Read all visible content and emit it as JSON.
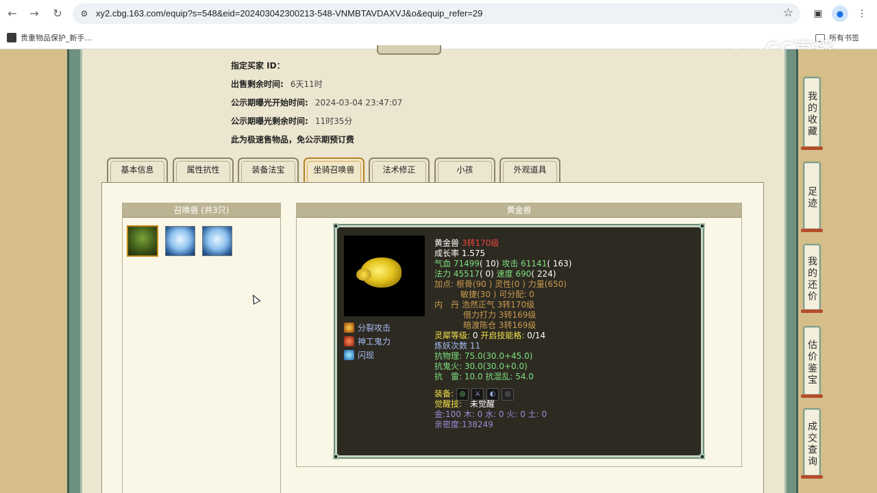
{
  "browser": {
    "url": "xy2.cbg.163.com/equip?s=548&eid=202403042300213-548-VNMBTAVDAXVJ&o&equip_refer=29",
    "bookmark": "贵重物品保护_新手...",
    "bookmarks_folder": "所有书签",
    "watermark": "CC直播",
    "icons": [
      "back-icon",
      "forward-icon",
      "reload-icon",
      "site-settings-icon",
      "star-icon",
      "sidebar-icon",
      "profile-icon",
      "menu-icon"
    ]
  },
  "info": {
    "rows": [
      {
        "label": "指定买家 ID：",
        "value": ""
      },
      {
        "label": "出售剩余时间:",
        "value": "6天11时"
      },
      {
        "label": "公示期曝光开始时间:",
        "value": "2024-03-04 23:47:07"
      },
      {
        "label": "公示期曝光剩余时间:",
        "value": "11时35分"
      },
      {
        "label": "此为极速售物品，免公示期预订费",
        "value": ""
      }
    ]
  },
  "tabs": [
    "基本信息",
    "属性抗性",
    "装备法宝",
    "坐骑召唤兽",
    "法术修正",
    "小孩",
    "外观道具"
  ],
  "active_tab": "坐骑召唤兽",
  "pets_panel": {
    "title": "召唤兽 (共3只)",
    "icons": [
      "green-warrior-pet-icon",
      "ice-pet-icon",
      "ice-pet-icon"
    ]
  },
  "detail": {
    "title": "黄金兽",
    "name": "黄金兽",
    "level": "3转170级",
    "growth": "成长率 1.575",
    "hp": {
      "label": "气血",
      "value": "71499",
      "extra": "( 10)"
    },
    "attack": {
      "label": "攻击",
      "value": "61141",
      "extra": "( 163)"
    },
    "mp": {
      "label": "法力",
      "value": "45517",
      "extra": "( 0)"
    },
    "speed": {
      "label": "速度",
      "value": "690",
      "extra": "( 224)"
    },
    "points_line1": "加点: 根骨(90 ) 灵性(0 ) 力量(650)",
    "points_line2": "敏捷(30 ) 可分配: 0",
    "neidan_label": "内　丹",
    "neidan": [
      "浩然正气 3转170级",
      "借力打力 3转169级",
      "暗渡陈仓 3转169级"
    ],
    "linxi_label": "灵犀等级:",
    "linxi_value": "0",
    "skill_cap_label": "开启技能格:",
    "skill_cap_value": "0/14",
    "lianyao": "炼妖次数 11",
    "resist1": "抗物理: 75.0(30.0+45.0)",
    "resist2": "抗鬼火: 30.0(30.0+0.0)",
    "resist3": "抗　雷: 10.0 抗混乱: 54.0",
    "equip_label": "装备:",
    "awake_label": "觉醒技:",
    "awake_value": "未觉醒",
    "elements": "金:100 木: 0 水: 0 火: 0 土: 0",
    "intimacy": "亲密度:138249",
    "skills": [
      "分裂攻击",
      "神工鬼力",
      "闪现"
    ]
  },
  "side_nav": [
    "我的收藏",
    "足迹",
    "我的还价",
    "估价鉴宝",
    "成交查询"
  ]
}
